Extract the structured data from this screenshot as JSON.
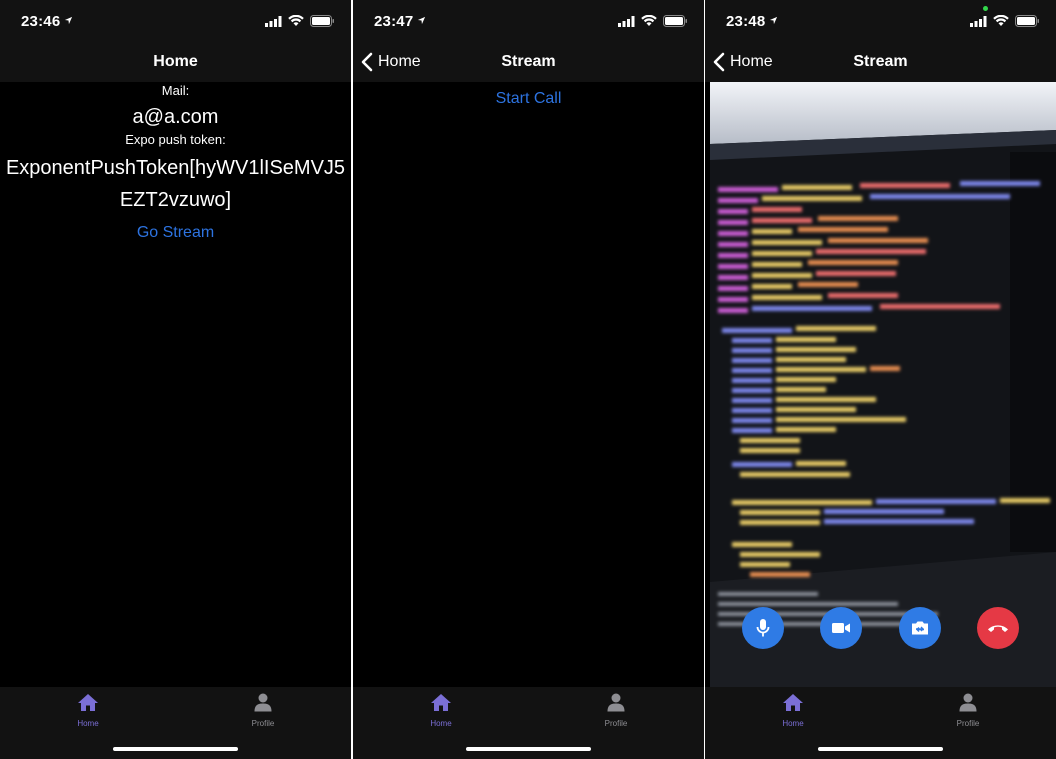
{
  "screens": [
    {
      "time": "23:46",
      "nav_title": "Home",
      "mail_label": "Mail:",
      "mail_value": "a@a.com",
      "token_label": "Expo push token:",
      "token_line1": "ExponentPushToken[hyWV1lISeMVJ5",
      "token_line2": "EZT2vzuwo]",
      "link_label": "Go Stream"
    },
    {
      "time": "23:47",
      "back_label": "Home",
      "nav_title": "Stream",
      "link_label": "Start Call"
    },
    {
      "time": "23:48",
      "back_label": "Home",
      "nav_title": "Stream",
      "call_controls": [
        "microphone-icon",
        "video-camera-icon",
        "switch-camera-icon",
        "end-call-icon"
      ]
    }
  ],
  "tabs": [
    {
      "label": "Home",
      "icon": "home-icon",
      "active": true
    },
    {
      "label": "Profile",
      "icon": "person-icon",
      "active": false
    }
  ],
  "colors": {
    "background": "#000000",
    "bar": "#121212",
    "link": "#2d73e0",
    "tab_active": "#7b6fd6",
    "tab_inactive": "#8e8e93",
    "control_blue": "#2f7be5",
    "end_call_red": "#e53945"
  }
}
